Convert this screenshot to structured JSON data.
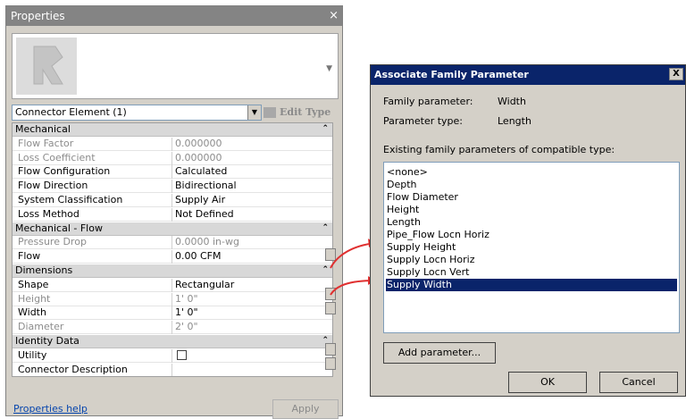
{
  "properties": {
    "title": "Properties",
    "close_glyph": "×",
    "type_selector": "Connector Element (1)",
    "edit_type_label": "Edit Type",
    "help_link": "Properties help",
    "apply_label": "Apply",
    "rows": [
      {
        "kind": "header",
        "label": "Mechanical"
      },
      {
        "kind": "row",
        "label": "Flow Factor",
        "value": "0.000000",
        "disabled": true
      },
      {
        "kind": "row",
        "label": "Loss Coefficient",
        "value": "0.000000",
        "disabled": true
      },
      {
        "kind": "row",
        "label": "Flow Configuration",
        "value": "Calculated"
      },
      {
        "kind": "row",
        "label": "Flow Direction",
        "value": "Bidirectional"
      },
      {
        "kind": "row",
        "label": "System Classification",
        "value": "Supply Air"
      },
      {
        "kind": "row",
        "label": "Loss Method",
        "value": "Not Defined"
      },
      {
        "kind": "header",
        "label": "Mechanical - Flow"
      },
      {
        "kind": "row",
        "label": "Pressure Drop",
        "value": "0.0000 in-wg",
        "disabled": true
      },
      {
        "kind": "row",
        "label": "Flow",
        "value": "0.00 CFM"
      },
      {
        "kind": "header",
        "label": "Dimensions"
      },
      {
        "kind": "row",
        "label": "Shape",
        "value": "Rectangular"
      },
      {
        "kind": "row",
        "label": "Height",
        "value": "1'  0\"",
        "disabled": true
      },
      {
        "kind": "row",
        "label": "Width",
        "value": "1'  0\""
      },
      {
        "kind": "row",
        "label": "Diameter",
        "value": "2'  0\"",
        "disabled": true
      },
      {
        "kind": "header",
        "label": "Identity Data"
      },
      {
        "kind": "row",
        "label": "Utility",
        "value": "",
        "checkbox": true
      },
      {
        "kind": "row",
        "label": "Connector Description",
        "value": ""
      }
    ]
  },
  "dialog": {
    "title": "Associate Family Parameter",
    "close_glyph": "X",
    "family_parameter_label": "Family parameter:",
    "family_parameter_value": "Width",
    "parameter_type_label": "Parameter type:",
    "parameter_type_value": "Length",
    "existing_label": "Existing family parameters of compatible type:",
    "items": [
      "<none>",
      "Depth",
      "Flow Diameter",
      "Height",
      "Length",
      "Pipe_Flow Locn Horiz",
      "Supply Height",
      "Supply Locn Horiz",
      "Supply Locn Vert",
      "Supply Width"
    ],
    "selected_item": "Supply Width",
    "add_parameter_label": "Add parameter...",
    "ok_label": "OK",
    "cancel_label": "Cancel"
  },
  "colors": {
    "arrow": "#e03030",
    "selection": "#0a246a",
    "titlebar": "#848484"
  }
}
